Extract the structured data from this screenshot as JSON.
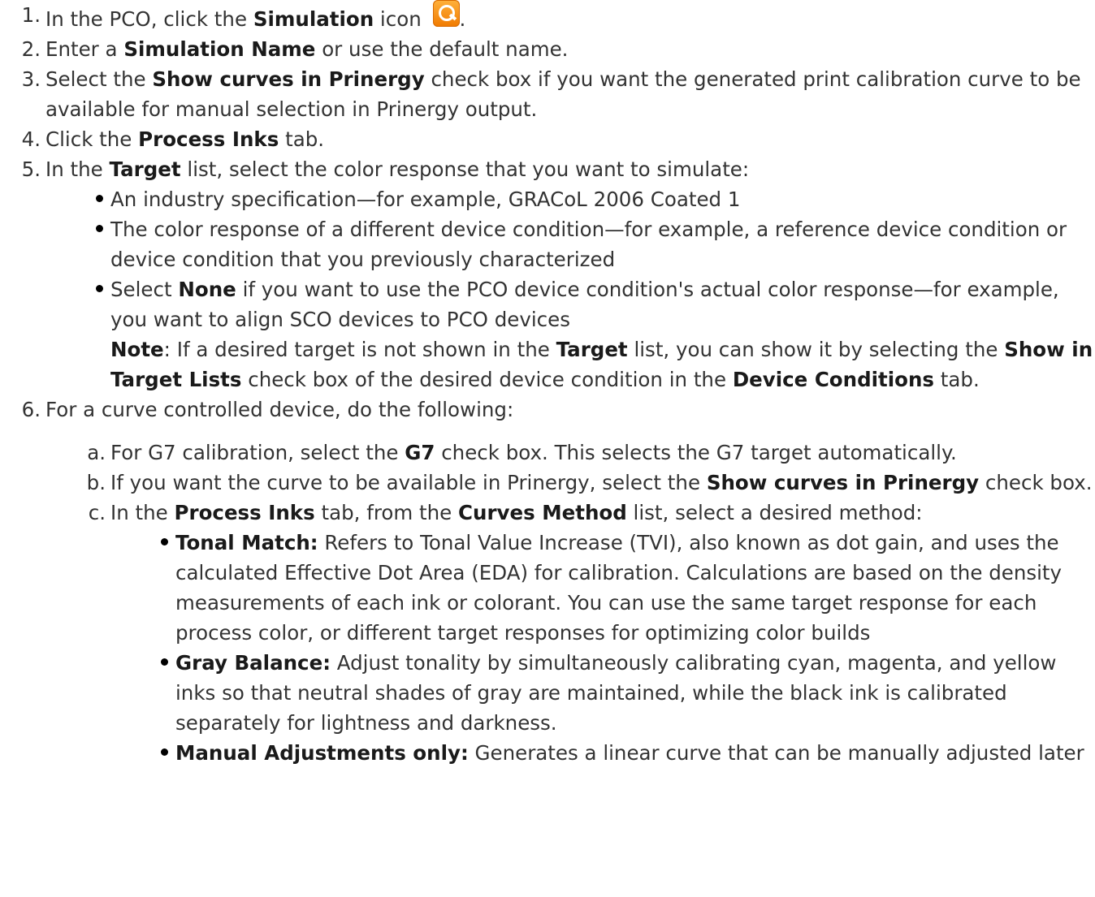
{
  "s1": {
    "num": "1.",
    "a": "In the PCO, click the ",
    "b1": "Simulation",
    "c": " icon",
    "icon": "simulation-icon",
    "d": "."
  },
  "s2": {
    "num": "2.",
    "a": "Enter a ",
    "b1": "Simulation Name",
    "c": " or use the default name."
  },
  "s3": {
    "num": "3.",
    "a": "Select the ",
    "b1": "Show curves in Prinergy",
    "c": " check box if you want the generated print calibration curve to be available for manual selection in Prinergy output."
  },
  "s4": {
    "num": "4.",
    "a": "Click the ",
    "b1": "Process Inks",
    "c": " tab."
  },
  "s5": {
    "num": "5.",
    "a": "In the ",
    "b1": "Target",
    "c": " list, select the color response that you want to simulate:",
    "bul1": "An industry specification—for example, GRACoL 2006 Coated 1",
    "bul2": "The color response of a different device condition—for example, a reference device condition or device condition that you previously characterized",
    "bul3": {
      "a": "Select ",
      "b1": "None",
      "c": " if you want to use the PCO device condition's actual color response—for example, you want to align SCO devices to PCO devices"
    },
    "note": {
      "b1": "Note",
      "a": ": If a desired target is not shown in the ",
      "b2": "Target",
      "c": " list, you can show it by selecting the ",
      "b3": "Show in Target Lists",
      "d": " check box of the desired device condition in the ",
      "b4": "Device Conditions",
      "e": " tab."
    }
  },
  "s6": {
    "num": "6.",
    "text": "For a curve controlled device, do the following:",
    "a": {
      "num": "a.",
      "a": "For G7 calibration, select the ",
      "b1": "G7",
      "c": " check box. This selects the G7 target automatically."
    },
    "b": {
      "num": "b.",
      "a": "If you want the curve to be available in Prinergy, select the ",
      "b1": "Show curves in Prinergy",
      "c": " check box."
    },
    "c": {
      "num": "c.",
      "a": "In the ",
      "b1": "Process Inks",
      "c": " tab, from the ",
      "b2": "Curves Method",
      "d": " list, select a desired method:",
      "m1": {
        "b": "Tonal Match:",
        "t": " Refers to Tonal Value Increase (TVI), also known as dot gain, and uses the calculated Effective Dot Area (EDA) for calibration. Calculations are based on the density measurements of each ink or colorant. You can use the same target response for each process color, or different target responses for optimizing color builds"
      },
      "m2": {
        "b": "Gray Balance:",
        "t": " Adjust tonality by simultaneously calibrating cyan, magenta, and yellow inks so that neutral shades of gray are maintained, while the black ink is calibrated separately for lightness and darkness."
      },
      "m3": {
        "b": "Manual Adjustments only:",
        "t": " Generates a linear curve that can be manually adjusted later"
      }
    }
  }
}
